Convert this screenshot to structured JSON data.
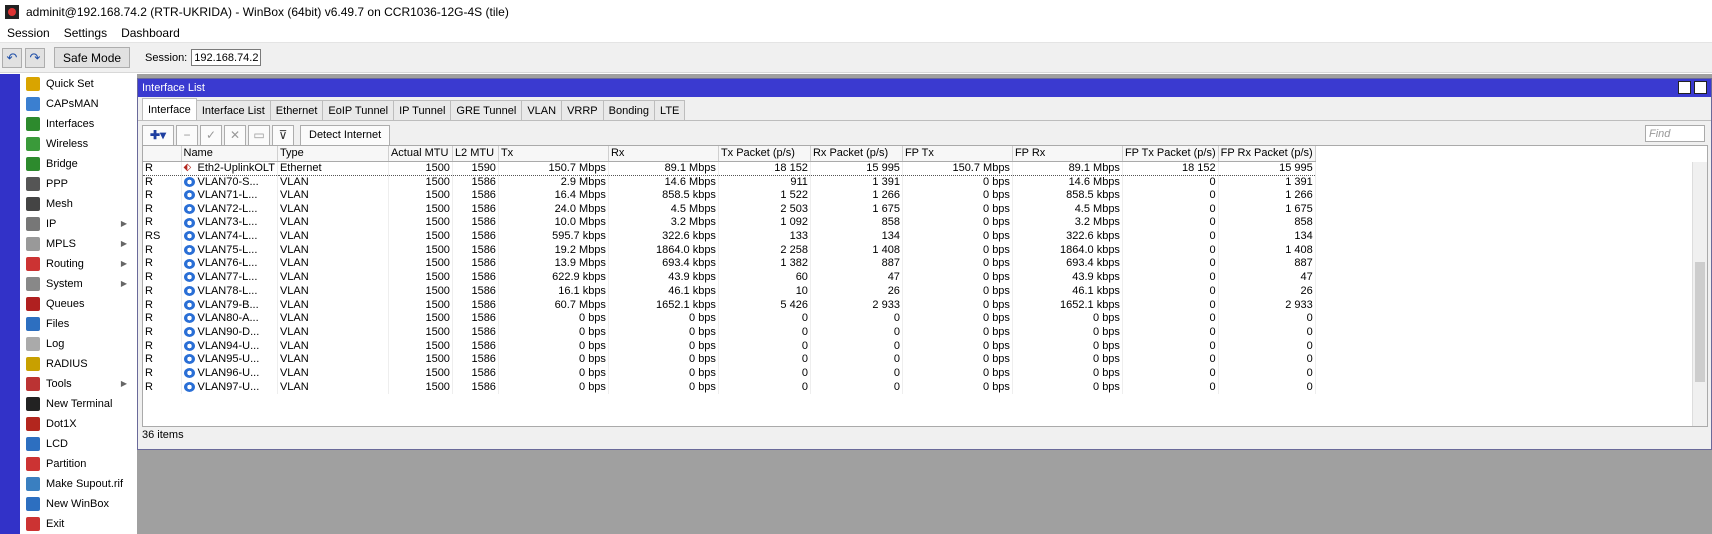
{
  "window_title": "adminit@192.168.74.2 (RTR-UKRIDA) - WinBox (64bit) v6.49.7 on CCR1036-12G-4S (tile)",
  "menu": [
    "Session",
    "Settings",
    "Dashboard"
  ],
  "toolbar": {
    "safe_mode": "Safe Mode",
    "session_label": "Session:",
    "session_value": "192.168.74.2"
  },
  "sidebar": {
    "items": [
      {
        "label": "Quick Set",
        "icon": "quickset-icon",
        "color": "#d9a400",
        "arrow": false
      },
      {
        "label": "CAPsMAN",
        "icon": "capsman-icon",
        "color": "#3b7fd0",
        "arrow": false
      },
      {
        "label": "Interfaces",
        "icon": "interfaces-icon",
        "color": "#2d8a2d",
        "arrow": false
      },
      {
        "label": "Wireless",
        "icon": "wireless-icon",
        "color": "#3a9a3a",
        "arrow": false
      },
      {
        "label": "Bridge",
        "icon": "bridge-icon",
        "color": "#2d8a2d",
        "arrow": false
      },
      {
        "label": "PPP",
        "icon": "ppp-icon",
        "color": "#555555",
        "arrow": false
      },
      {
        "label": "Mesh",
        "icon": "mesh-icon",
        "color": "#444444",
        "arrow": false
      },
      {
        "label": "IP",
        "icon": "ip-icon",
        "color": "#777777",
        "arrow": true
      },
      {
        "label": "MPLS",
        "icon": "mpls-icon",
        "color": "#999999",
        "arrow": true
      },
      {
        "label": "Routing",
        "icon": "routing-icon",
        "color": "#cc3333",
        "arrow": true
      },
      {
        "label": "System",
        "icon": "system-icon",
        "color": "#888888",
        "arrow": true
      },
      {
        "label": "Queues",
        "icon": "queues-icon",
        "color": "#b02020",
        "arrow": false
      },
      {
        "label": "Files",
        "icon": "files-icon",
        "color": "#2d6fc0",
        "arrow": false
      },
      {
        "label": "Log",
        "icon": "log-icon",
        "color": "#aaaaaa",
        "arrow": false
      },
      {
        "label": "RADIUS",
        "icon": "radius-icon",
        "color": "#c8a000",
        "arrow": false
      },
      {
        "label": "Tools",
        "icon": "tools-icon",
        "color": "#b33",
        "arrow": true
      },
      {
        "label": "New Terminal",
        "icon": "terminal-icon",
        "color": "#222222",
        "arrow": false
      },
      {
        "label": "Dot1X",
        "icon": "dot1x-icon",
        "color": "#b3261e",
        "arrow": false
      },
      {
        "label": "LCD",
        "icon": "lcd-icon",
        "color": "#2d6fc0",
        "arrow": false
      },
      {
        "label": "Partition",
        "icon": "partition-icon",
        "color": "#cc3333",
        "arrow": false
      },
      {
        "label": "Make Supout.rif",
        "icon": "supout-icon",
        "color": "#3a7fc0",
        "arrow": false
      },
      {
        "label": "New WinBox",
        "icon": "winbox-icon",
        "color": "#2d6fc0",
        "arrow": false
      },
      {
        "label": "Exit",
        "icon": "exit-icon",
        "color": "#cc3333",
        "arrow": false
      }
    ]
  },
  "interface_window": {
    "title": "Interface List",
    "tabs": [
      "Interface",
      "Interface List",
      "Ethernet",
      "EoIP Tunnel",
      "IP Tunnel",
      "GRE Tunnel",
      "VLAN",
      "VRRP",
      "Bonding",
      "LTE"
    ],
    "active_tab": 0,
    "detect_internet": "Detect Internet",
    "find_placeholder": "Find",
    "columns": [
      "",
      "Name",
      "Type",
      "Actual MTU",
      "L2 MTU",
      "Tx",
      "Rx",
      "Tx Packet (p/s)",
      "Rx Packet (p/s)",
      "FP Tx",
      "FP Rx",
      "FP Tx Packet (p/s)",
      "FP Rx Packet (p/s)"
    ],
    "rows": [
      {
        "flag": "R",
        "icon": "ethernet",
        "cells": [
          "Eth2-UplinkOLT",
          "Ethernet",
          "1500",
          "1590",
          "150.7 Mbps",
          "89.1 Mbps",
          "18 152",
          "15 995",
          "150.7 Mbps",
          "89.1 Mbps",
          "18 152",
          "15 995"
        ]
      },
      {
        "flag": "R",
        "icon": "vlan",
        "cells": [
          "VLAN70-S...",
          "VLAN",
          "1500",
          "1586",
          "2.9 Mbps",
          "14.6 Mbps",
          "911",
          "1 391",
          "0 bps",
          "14.6 Mbps",
          "0",
          "1 391"
        ]
      },
      {
        "flag": "R",
        "icon": "vlan",
        "cells": [
          "VLAN71-L...",
          "VLAN",
          "1500",
          "1586",
          "16.4 Mbps",
          "858.5 kbps",
          "1 522",
          "1 266",
          "0 bps",
          "858.5 kbps",
          "0",
          "1 266"
        ]
      },
      {
        "flag": "R",
        "icon": "vlan",
        "cells": [
          "VLAN72-L...",
          "VLAN",
          "1500",
          "1586",
          "24.0 Mbps",
          "4.5 Mbps",
          "2 503",
          "1 675",
          "0 bps",
          "4.5 Mbps",
          "0",
          "1 675"
        ]
      },
      {
        "flag": "R",
        "icon": "vlan",
        "cells": [
          "VLAN73-L...",
          "VLAN",
          "1500",
          "1586",
          "10.0 Mbps",
          "3.2 Mbps",
          "1 092",
          "858",
          "0 bps",
          "3.2 Mbps",
          "0",
          "858"
        ]
      },
      {
        "flag": "RS",
        "icon": "vlan",
        "cells": [
          "VLAN74-L...",
          "VLAN",
          "1500",
          "1586",
          "595.7 kbps",
          "322.6 kbps",
          "133",
          "134",
          "0 bps",
          "322.6 kbps",
          "0",
          "134"
        ]
      },
      {
        "flag": "R",
        "icon": "vlan",
        "cells": [
          "VLAN75-L...",
          "VLAN",
          "1500",
          "1586",
          "19.2 Mbps",
          "1864.0 kbps",
          "2 258",
          "1 408",
          "0 bps",
          "1864.0 kbps",
          "0",
          "1 408"
        ]
      },
      {
        "flag": "R",
        "icon": "vlan",
        "cells": [
          "VLAN76-L...",
          "VLAN",
          "1500",
          "1586",
          "13.9 Mbps",
          "693.4 kbps",
          "1 382",
          "887",
          "0 bps",
          "693.4 kbps",
          "0",
          "887"
        ]
      },
      {
        "flag": "R",
        "icon": "vlan",
        "cells": [
          "VLAN77-L...",
          "VLAN",
          "1500",
          "1586",
          "622.9 kbps",
          "43.9 kbps",
          "60",
          "47",
          "0 bps",
          "43.9 kbps",
          "0",
          "47"
        ]
      },
      {
        "flag": "R",
        "icon": "vlan",
        "cells": [
          "VLAN78-L...",
          "VLAN",
          "1500",
          "1586",
          "16.1 kbps",
          "46.1 kbps",
          "10",
          "26",
          "0 bps",
          "46.1 kbps",
          "0",
          "26"
        ]
      },
      {
        "flag": "R",
        "icon": "vlan",
        "cells": [
          "VLAN79-B...",
          "VLAN",
          "1500",
          "1586",
          "60.7 Mbps",
          "1652.1 kbps",
          "5 426",
          "2 933",
          "0 bps",
          "1652.1 kbps",
          "0",
          "2 933"
        ]
      },
      {
        "flag": "R",
        "icon": "vlan",
        "cells": [
          "VLAN80-A...",
          "VLAN",
          "1500",
          "1586",
          "0 bps",
          "0 bps",
          "0",
          "0",
          "0 bps",
          "0 bps",
          "0",
          "0"
        ]
      },
      {
        "flag": "R",
        "icon": "vlan",
        "cells": [
          "VLAN90-D...",
          "VLAN",
          "1500",
          "1586",
          "0 bps",
          "0 bps",
          "0",
          "0",
          "0 bps",
          "0 bps",
          "0",
          "0"
        ]
      },
      {
        "flag": "R",
        "icon": "vlan",
        "cells": [
          "VLAN94-U...",
          "VLAN",
          "1500",
          "1586",
          "0 bps",
          "0 bps",
          "0",
          "0",
          "0 bps",
          "0 bps",
          "0",
          "0"
        ]
      },
      {
        "flag": "R",
        "icon": "vlan",
        "cells": [
          "VLAN95-U...",
          "VLAN",
          "1500",
          "1586",
          "0 bps",
          "0 bps",
          "0",
          "0",
          "0 bps",
          "0 bps",
          "0",
          "0"
        ]
      },
      {
        "flag": "R",
        "icon": "vlan",
        "cells": [
          "VLAN96-U...",
          "VLAN",
          "1500",
          "1586",
          "0 bps",
          "0 bps",
          "0",
          "0",
          "0 bps",
          "0 bps",
          "0",
          "0"
        ]
      },
      {
        "flag": "R",
        "icon": "vlan",
        "cells": [
          "VLAN97-U...",
          "VLAN",
          "1500",
          "1586",
          "0 bps",
          "0 bps",
          "0",
          "0",
          "0 bps",
          "0 bps",
          "0",
          "0"
        ]
      }
    ],
    "status": "36 items"
  }
}
